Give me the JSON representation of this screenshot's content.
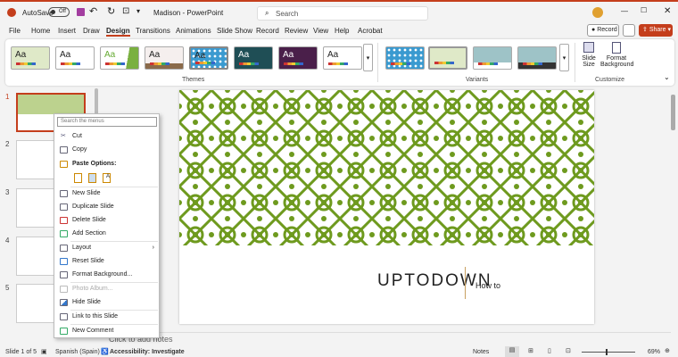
{
  "titlebar": {
    "autosave": "AutoSave",
    "toggle": "Off",
    "title": "Madison - PowerPoint",
    "search_placeholder": "Search"
  },
  "tabs": [
    "File",
    "Home",
    "Insert",
    "Draw",
    "Design",
    "Transitions",
    "Animations",
    "Slide Show",
    "Record",
    "Review",
    "View",
    "Help",
    "Acrobat"
  ],
  "actions": {
    "record": "Record",
    "share": "Share"
  },
  "ribbon": {
    "theme_sample": "Aa",
    "themes_label": "Themes",
    "variants_label": "Variants",
    "customize_label": "Customize",
    "slide_size": "Slide Size",
    "format_background": "Format Background"
  },
  "thumbnails": [
    "1",
    "2",
    "3",
    "4",
    "5"
  ],
  "context_menu": {
    "search_placeholder": "Search the menus",
    "cut": "Cut",
    "copy": "Copy",
    "paste_options": "Paste Options:",
    "new_slide": "New Slide",
    "duplicate_slide": "Duplicate Slide",
    "delete_slide": "Delete Slide",
    "add_section": "Add Section",
    "layout": "Layout",
    "reset_slide": "Reset Slide",
    "format_background": "Format Background...",
    "photo_album": "Photo Album...",
    "hide_slide": "Hide Slide",
    "link_slide": "Link to this Slide",
    "new_comment": "New Comment"
  },
  "slide": {
    "title": "UPTODOWN",
    "subtitle": "How to"
  },
  "notes_placeholder": "Click to add notes",
  "status": {
    "slide": "Slide 1 of 5",
    "language": "Spanish (Spain)",
    "accessibility": "Accessibility: Investigate",
    "notes": "Notes",
    "zoom": "69%"
  },
  "colors": {
    "accent": "#c43e1c",
    "pattern": "#6e9a1e"
  }
}
